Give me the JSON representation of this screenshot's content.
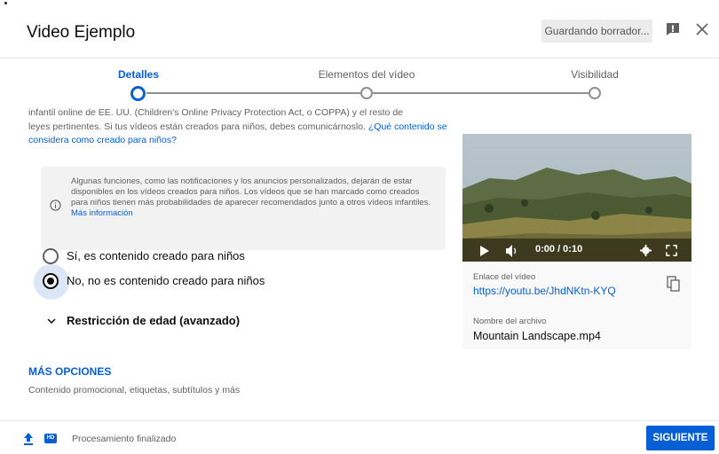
{
  "header": {
    "title": "Video Ejemplo",
    "draft_status": "Guardando borrador...",
    "feedback_icon": "feedback-icon",
    "close_icon": "close-icon"
  },
  "stepper": {
    "steps": [
      {
        "label": "Detalles",
        "state": "active"
      },
      {
        "label": "Elementos del vídeo",
        "state": "inactive"
      },
      {
        "label": "Visibilidad",
        "state": "inactive"
      }
    ]
  },
  "audience": {
    "truncated_line": "infantil online de EE. UU. (Children's Online Privacy Protection Act, o COPPA) y el resto de",
    "text": "leyes pertinentes. Si tus vídeos están creados para niños, debes comunicárnoslo.",
    "link": "¿Qué contenido se considera como creado para niños?",
    "info_text": "Algunas funciones, como las notificaciones y los anuncios personalizados, dejarán de estar disponibles en los vídeos creados para niños. Los vídeos que se han marcado como creados para niños tienen más probabilidades de aparecer recomendados junto a otros vídeos infantiles.",
    "info_link": "Más información",
    "option_yes": "Sí, es contenido creado para niños",
    "option_no": "No, no es contenido creado para niños",
    "selected": "option_no"
  },
  "age_restriction": {
    "label": "Restricción de edad (avanzado)"
  },
  "more_options": {
    "label": "MÁS OPCIONES",
    "subtitle": "Contenido promocional, etiquetas, subtítulos y más"
  },
  "video_card": {
    "time": "0:00 / 0:10",
    "link_label": "Enlace del vídeo",
    "link_url": "https://youtu.be/JhdNKtn-KYQ",
    "file_label": "Nombre del archivo",
    "file_name": "Mountain Landscape.mp4",
    "progress": 0
  },
  "footer": {
    "hd_badge": "HD",
    "status": "Procesamiento finalizado",
    "next_button": "SIGUIENTE"
  },
  "colors": {
    "accent": "#065fd4",
    "text": "#0d0d0d",
    "muted": "#606060",
    "info_bg": "#f2f2f2"
  }
}
